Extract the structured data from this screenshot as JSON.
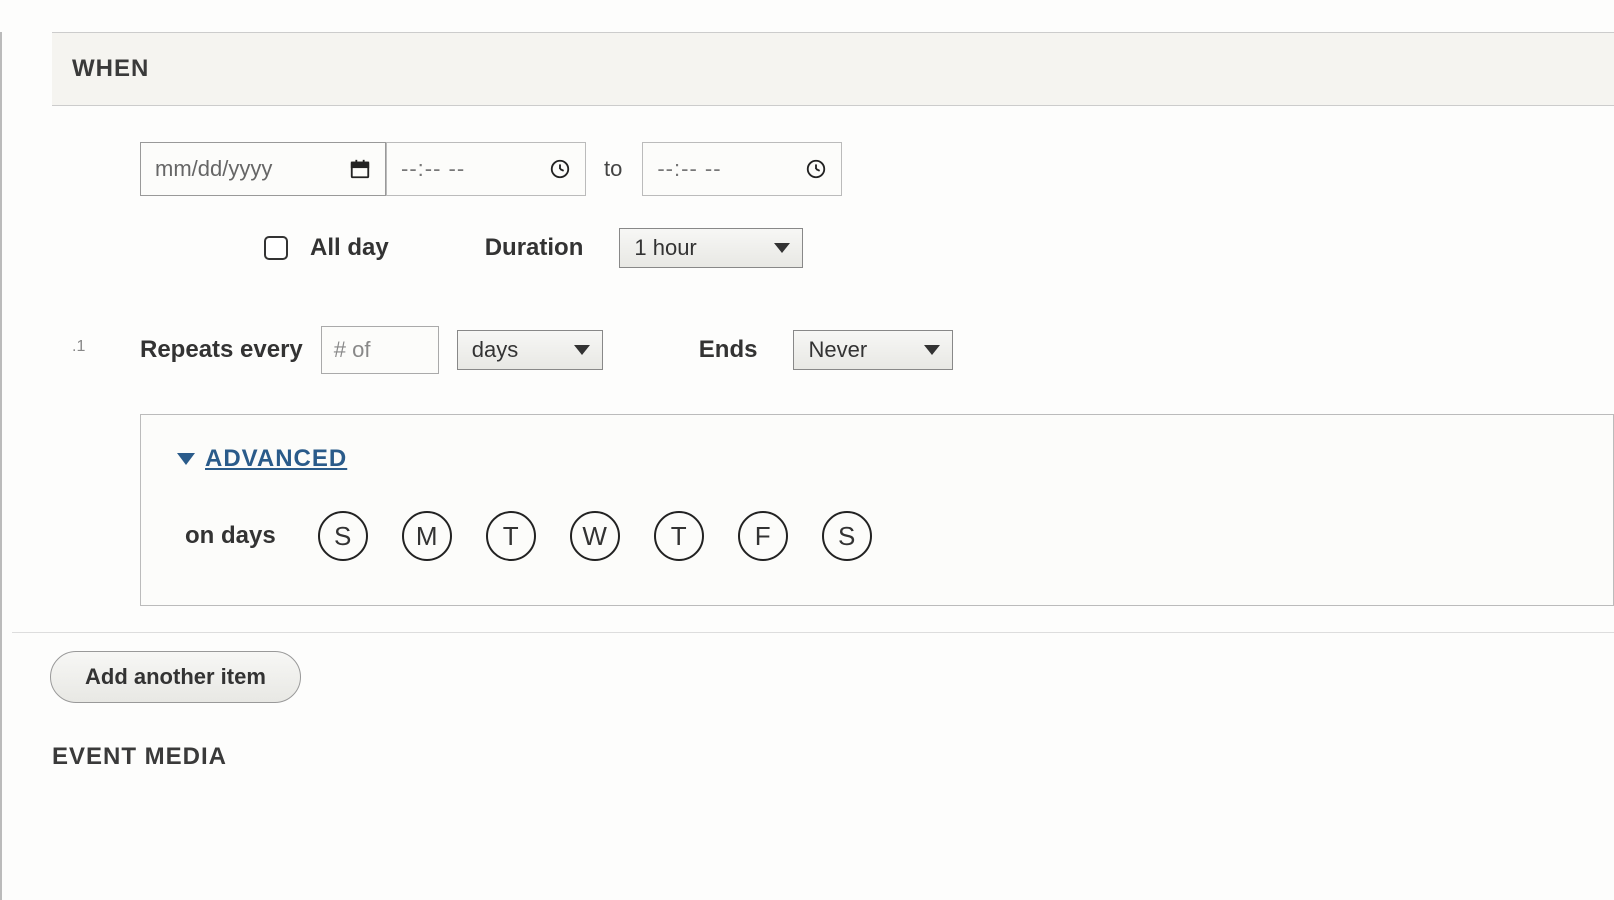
{
  "section_when_title": "WHEN",
  "section_next_title": "EVENT MEDIA",
  "date": {
    "placeholder": "mm/dd/yyyy"
  },
  "time": {
    "start_placeholder": "--:-- --",
    "to_label": "to",
    "end_placeholder": "--:-- --"
  },
  "allday": {
    "label": "All day"
  },
  "duration": {
    "label": "Duration",
    "value": "1 hour"
  },
  "repeats": {
    "label": "Repeats every",
    "num_placeholder": "# of",
    "unit": "days",
    "ends_label": "Ends",
    "ends_value": "Never",
    "row_marker": ".1"
  },
  "advanced": {
    "label": "ADVANCED",
    "ondays_label": "on days",
    "days": [
      "S",
      "M",
      "T",
      "W",
      "T",
      "F",
      "S"
    ]
  },
  "add_item_label": "Add another item"
}
